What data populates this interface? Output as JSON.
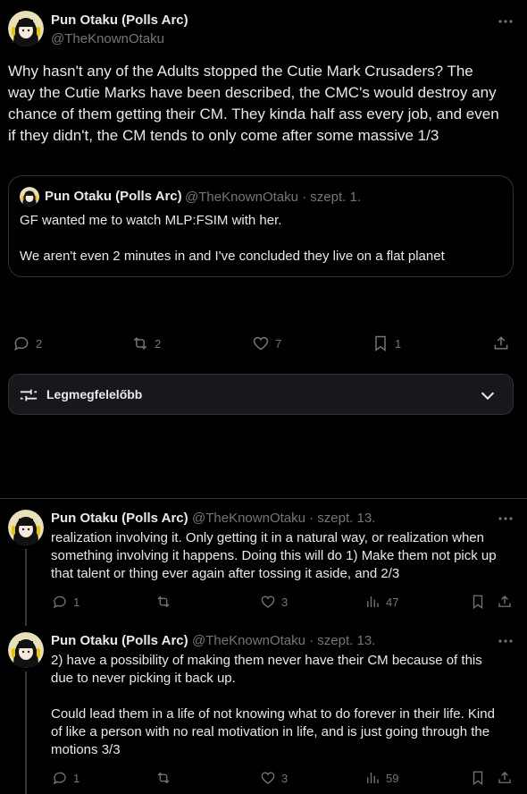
{
  "main_post": {
    "author_name": "Pun Otaku (Polls Arc)",
    "author_handle": "@TheKnownOtaku",
    "text_lines": [
      "Why hasn't any of the Adults stopped the Cutie Mark Crusaders? The",
      "way the Cutie Marks have been described, the CMC's would destroy any",
      "chance of them getting their CM. They kinda half ass every job, and even",
      "if they didn't, the CM tends to only come after some massive 1/3"
    ],
    "quote": {
      "author_name": "Pun Otaku (Polls Arc)",
      "meta": "@TheKnownOtaku · szept. 1.",
      "line1": "GF wanted me to watch MLP:FSIM with her.",
      "line2": "We aren't even 2 minutes in and I've concluded they live on a flat planet"
    },
    "stats": {
      "replies": "2",
      "reposts": "2",
      "likes": "7",
      "bookmarks": "1"
    }
  },
  "sort": {
    "label": "Legmegfelelőbb"
  },
  "replies": [
    {
      "author_name": "Pun Otaku (Polls Arc)",
      "meta": "@TheKnownOtaku · szept. 13.",
      "text_lines": [
        "realization involving it. Only getting it in a natural way, or realization when",
        "something involving it happens. Doing this will do 1) Make them not pick up",
        "that talent or thing ever again after tossing it aside, and 2/3"
      ],
      "stats": {
        "replies": "1",
        "reposts": "",
        "likes": "3",
        "views": "47"
      }
    },
    {
      "author_name": "Pun Otaku (Polls Arc)",
      "meta": "@TheKnownOtaku · szept. 13.",
      "text_lines": [
        "2) have a possibility of making them never have their CM because of this",
        "due to never picking it back up.",
        "",
        "Could lead them in a life of not knowing what to do forever in their life. Kind",
        "of like a person with no real motivation in life, and is just going through the",
        "motions 3/3"
      ],
      "stats": {
        "replies": "1",
        "reposts": "",
        "likes": "3",
        "views": "59"
      }
    }
  ],
  "icons": {
    "more": "more-dots-icon",
    "reply": "reply-bubble-icon",
    "repost": "repost-icon",
    "like": "heart-icon",
    "bookmark": "bookmark-icon",
    "share": "share-icon",
    "views": "views-bar-icon",
    "sort": "sliders-icon",
    "chevron": "chevron-down-icon"
  },
  "colors": {
    "background": "#000000",
    "text": "#e7e9ea",
    "muted": "#71767b",
    "border": "#2f3336",
    "sort_bar_bg": "#16181c"
  }
}
